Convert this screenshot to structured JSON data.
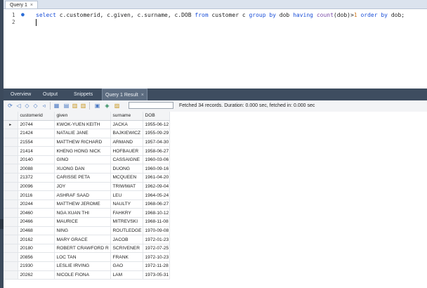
{
  "editor": {
    "tab_label": "Query 1",
    "tab_close": "×",
    "line_numbers": [
      "1",
      "2"
    ],
    "sql_tokens": [
      {
        "t": "select",
        "k": "kw"
      },
      {
        "t": " c.customerid, c.given, c.surname, c.DOB ",
        "k": ""
      },
      {
        "t": "from",
        "k": "kw"
      },
      {
        "t": " customer c ",
        "k": ""
      },
      {
        "t": "group by",
        "k": "kw"
      },
      {
        "t": " dob ",
        "k": ""
      },
      {
        "t": "having",
        "k": "kw"
      },
      {
        "t": " ",
        "k": ""
      },
      {
        "t": "count",
        "k": "fn"
      },
      {
        "t": "(dob)>",
        "k": ""
      },
      {
        "t": "1",
        "k": "num"
      },
      {
        "t": " ",
        "k": ""
      },
      {
        "t": "order by",
        "k": "kw"
      },
      {
        "t": " dob;",
        "k": ""
      }
    ]
  },
  "panel_tabs": [
    {
      "label": "Overview"
    },
    {
      "label": "Output"
    },
    {
      "label": "Snippets"
    },
    {
      "label": "Query 1 Result",
      "active": true
    }
  ],
  "panel_tab_close": "×",
  "toolbar": {
    "status": "Fetched 34 records. Duration: 0.000 sec, fetched in: 0.000 sec"
  },
  "grid": {
    "columns": [
      "customerid",
      "given",
      "surname",
      "DOB"
    ],
    "rows": [
      [
        "20744",
        "KWOK-YUEN KEITH",
        "JACKA",
        "1955-06-12"
      ],
      [
        "21424",
        "NATALIE JANE",
        "BAJKIEWICZ",
        "1955-09-29"
      ],
      [
        "21554",
        "MATTHEW RICHARD",
        "ARMAND",
        "1957-04-30"
      ],
      [
        "21414",
        "KHENG HONG NICK",
        "HOFBAUER",
        "1958-06-27"
      ],
      [
        "20140",
        "GINO",
        "CASSAIGNE",
        "1960-03-06"
      ],
      [
        "20088",
        "XUONG DAN",
        "DUONG",
        "1960-09-16"
      ],
      [
        "21372",
        "CARISSE PETA",
        "MCQUEEN",
        "1961-04-20"
      ],
      [
        "20096",
        "JOY",
        "TRIWIWAT",
        "1962-09-04"
      ],
      [
        "20116",
        "ASHRAF SAAD",
        "LEU",
        "1964-05-24"
      ],
      [
        "20244",
        "MATTHEW JEROME",
        "NAULTY",
        "1968-06-27"
      ],
      [
        "20460",
        "NGA XUAN THI",
        "FAHKRY",
        "1968-10-12"
      ],
      [
        "20466",
        "MAURICE",
        "MITREVSKI",
        "1968-11-08"
      ],
      [
        "20468",
        "NING",
        "ROUTLEDGE",
        "1970-09-08"
      ],
      [
        "20162",
        "MARY GRACE",
        "JACOB",
        "1972-01-23"
      ],
      [
        "20180",
        "ROBERT CRAWFORD R",
        "SCRIVENER",
        "1972-07-25"
      ],
      [
        "20856",
        "LOC TAN",
        "FRANK",
        "1972-10-23"
      ],
      [
        "21930",
        "LESLIE IRVING",
        "GAO",
        "1972-11-28"
      ],
      [
        "20262",
        "NICOLE FIONA",
        "LAM",
        "1973-05-31"
      ]
    ],
    "current_row_marker": "▸"
  },
  "colors": {
    "keyword": "#1b4fd8",
    "function": "#7a4aa8",
    "number": "#d07a20",
    "panel_bg": "#3e4d60"
  }
}
